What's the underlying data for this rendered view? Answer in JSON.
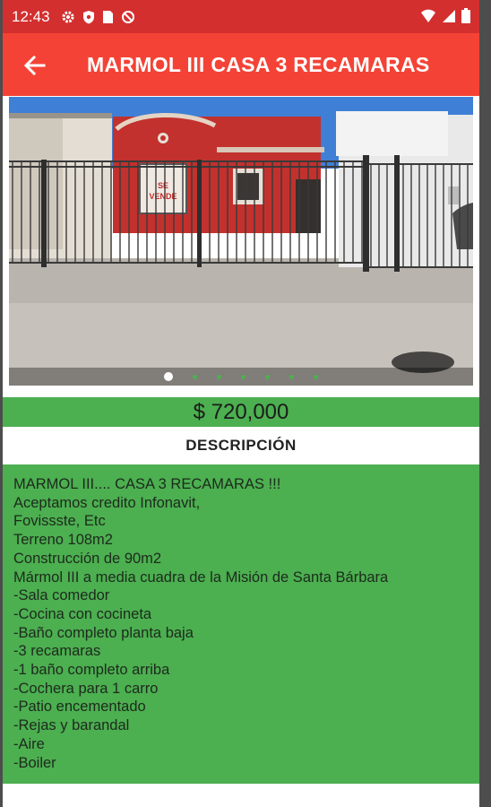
{
  "status_bar": {
    "time": "12:43",
    "left_icons": [
      "gear-icon",
      "shield-icon",
      "sim-card-icon",
      "do-not-disturb-icon"
    ],
    "right_icons": [
      "wifi-icon",
      "signal-icon",
      "battery-icon"
    ]
  },
  "app_bar": {
    "title": "MARMOL III CASA 3 RECAMARAS",
    "back_icon": "arrow-left-icon"
  },
  "gallery": {
    "image": "house-photo",
    "sign_text": "SE VENDE",
    "page_count": 7,
    "active_index": 0
  },
  "listing": {
    "price": "$ 720,000",
    "description_header": "DESCRIPCIÓN",
    "description_lines": [
      "MARMOL III.... CASA 3 RECAMARAS !!!",
      "Aceptamos credito Infonavit,",
      "Fovissste, Etc",
      "Terreno 108m2",
      "Construcción de 90m2",
      "Mármol III a media cuadra de la Misión de Santa Bárbara",
      "-Sala comedor",
      "-Cocina con cocineta",
      "-Baño completo planta baja",
      "-3 recamaras",
      "-1 baño completo arriba",
      "-Cochera para 1 carro",
      "-Patio encementado",
      "-Rejas y barandal",
      "-Aire",
      "-Boiler"
    ]
  },
  "colors": {
    "status_bar": "#d32f2f",
    "app_bar": "#f44336",
    "accent_green": "#4caf50",
    "dot_active": "#ffffff",
    "dot_inactive": "#4caf50"
  }
}
